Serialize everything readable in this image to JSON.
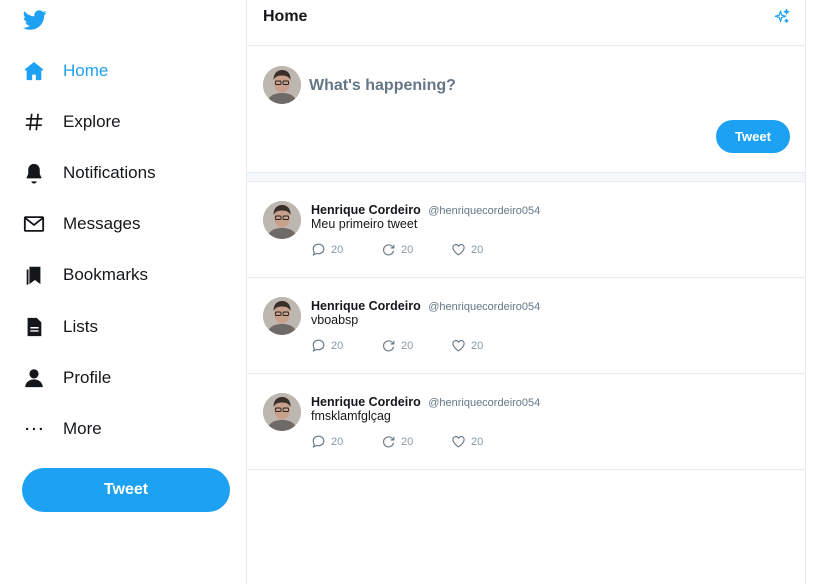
{
  "brand": {
    "icon": "twitter-bird-icon",
    "accent": "#1da1f2"
  },
  "sidebar": {
    "items": [
      {
        "label": "Home",
        "icon": "home-icon",
        "active": true
      },
      {
        "label": "Explore",
        "icon": "hashtag-icon"
      },
      {
        "label": "Notifications",
        "icon": "bell-icon"
      },
      {
        "label": "Messages",
        "icon": "envelope-icon"
      },
      {
        "label": "Bookmarks",
        "icon": "bookmark-icon"
      },
      {
        "label": "Lists",
        "icon": "list-icon"
      },
      {
        "label": "Profile",
        "icon": "person-icon"
      },
      {
        "label": "More",
        "icon": "more-dots-icon"
      }
    ],
    "tweet_button": "Tweet"
  },
  "header": {
    "title": "Home",
    "icon": "sparkle-icon"
  },
  "composer": {
    "placeholder": "What's happening?",
    "tweet_button": "Tweet"
  },
  "feed": [
    {
      "name": "Henrique Cordeiro",
      "handle": "@henriquecordeiro054",
      "text": "Meu primeiro tweet",
      "replies": "20",
      "retweets": "20",
      "likes": "20"
    },
    {
      "name": "Henrique Cordeiro",
      "handle": "@henriquecordeiro054",
      "text": "vboabsp",
      "replies": "20",
      "retweets": "20",
      "likes": "20"
    },
    {
      "name": "Henrique Cordeiro",
      "handle": "@henriquecordeiro054",
      "text": "fmsklamfglçag",
      "replies": "20",
      "retweets": "20",
      "likes": "20"
    }
  ]
}
